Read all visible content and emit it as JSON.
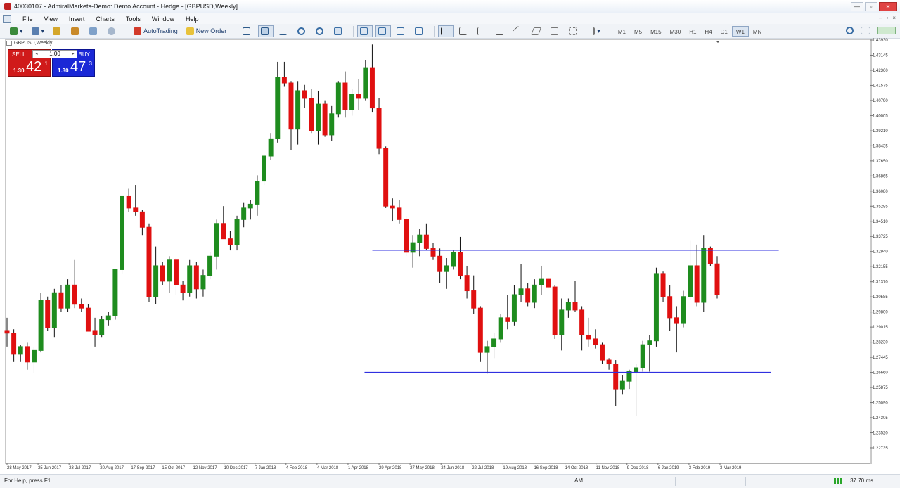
{
  "window": {
    "title": "40030107 - AdmiralMarkets-Demo: Demo Account - Hedge - [GBPUSD,Weekly]",
    "controls": [
      "—",
      "▫",
      "✕"
    ]
  },
  "menu": {
    "items": [
      "File",
      "View",
      "Insert",
      "Charts",
      "Tools",
      "Window",
      "Help"
    ]
  },
  "toolbar": {
    "autotrading_label": "AutoTrading",
    "new_order_label": "New Order",
    "timeframes": [
      "M1",
      "M5",
      "M15",
      "M30",
      "H1",
      "H4",
      "D1",
      "W1",
      "MN"
    ],
    "active_timeframe": "W1"
  },
  "chart_tab": {
    "label": "GBPUSD,Weekly"
  },
  "one_click": {
    "sell_label": "SELL",
    "buy_label": "BUY",
    "lot": "1.00",
    "sell_price_small": "1.30",
    "sell_price_big": "42",
    "sell_price_sup": "1",
    "buy_price_small": "1.30",
    "buy_price_big": "47",
    "buy_price_sup": "3"
  },
  "chart_data": {
    "type": "candlestick",
    "symbol": "GBPUSD",
    "timeframe": "Weekly",
    "ylim": [
      1.2193,
      1.4393
    ],
    "y_ticks": [
      "1.43930",
      "1.43145",
      "1.42360",
      "1.41575",
      "1.40790",
      "1.40005",
      "1.39210",
      "1.38435",
      "1.37650",
      "1.36865",
      "1.36080",
      "1.35295",
      "1.34510",
      "1.33725",
      "1.32940",
      "1.32155",
      "1.31370",
      "1.30585",
      "1.29800",
      "1.29015",
      "1.28230",
      "1.27445",
      "1.26660",
      "1.25875",
      "1.25090",
      "1.24305",
      "1.23520",
      "1.22735"
    ],
    "x_ticks": [
      "28 May 2017",
      "25 Jun 2017",
      "23 Jul 2017",
      "20 Aug 2017",
      "17 Sep 2017",
      "15 Oct 2017",
      "12 Nov 2017",
      "10 Dec 2017",
      "7 Jan 2018",
      "4 Feb 2018",
      "4 Mar 2018",
      "1 Apr 2018",
      "29 Apr 2018",
      "27 May 2018",
      "24 Jun 2018",
      "22 Jul 2018",
      "19 Aug 2018",
      "16 Sep 2018",
      "14 Oct 2018",
      "11 Nov 2018",
      "9 Dec 2018",
      "6 Jan 2019",
      "3 Feb 2019",
      "3 Mar 2019"
    ],
    "bull_color": "#1e8c1e",
    "bear_color": "#e01010",
    "candles": [
      [
        1.288,
        1.295,
        1.28,
        1.287
      ],
      [
        1.287,
        1.289,
        1.272,
        1.276
      ],
      [
        1.276,
        1.281,
        1.272,
        1.28
      ],
      [
        1.28,
        1.282,
        1.268,
        1.272
      ],
      [
        1.272,
        1.28,
        1.266,
        1.278
      ],
      [
        1.278,
        1.308,
        1.277,
        1.304
      ],
      [
        1.304,
        1.306,
        1.288,
        1.29
      ],
      [
        1.29,
        1.31,
        1.285,
        1.308
      ],
      [
        1.308,
        1.312,
        1.298,
        1.3
      ],
      [
        1.3,
        1.315,
        1.298,
        1.312
      ],
      [
        1.312,
        1.325,
        1.3,
        1.302
      ],
      [
        1.302,
        1.305,
        1.298,
        1.3
      ],
      [
        1.3,
        1.302,
        1.288,
        1.288
      ],
      [
        1.288,
        1.295,
        1.28,
        1.286
      ],
      [
        1.286,
        1.296,
        1.285,
        1.294
      ],
      [
        1.294,
        1.298,
        1.291,
        1.296
      ],
      [
        1.296,
        1.32,
        1.294,
        1.32
      ],
      [
        1.32,
        1.358,
        1.318,
        1.358
      ],
      [
        1.358,
        1.362,
        1.35,
        1.352
      ],
      [
        1.352,
        1.364,
        1.348,
        1.35
      ],
      [
        1.35,
        1.351,
        1.338,
        1.342
      ],
      [
        1.342,
        1.344,
        1.303,
        1.306
      ],
      [
        1.306,
        1.332,
        1.302,
        1.322
      ],
      [
        1.322,
        1.324,
        1.312,
        1.314
      ],
      [
        1.314,
        1.327,
        1.308,
        1.325
      ],
      [
        1.325,
        1.326,
        1.307,
        1.312
      ],
      [
        1.312,
        1.314,
        1.304,
        1.308
      ],
      [
        1.308,
        1.325,
        1.306,
        1.322
      ],
      [
        1.322,
        1.324,
        1.305,
        1.31
      ],
      [
        1.31,
        1.32,
        1.306,
        1.317
      ],
      [
        1.317,
        1.329,
        1.315,
        1.327
      ],
      [
        1.327,
        1.346,
        1.32,
        1.344
      ],
      [
        1.344,
        1.353,
        1.336,
        1.336
      ],
      [
        1.336,
        1.34,
        1.33,
        1.333
      ],
      [
        1.333,
        1.348,
        1.33,
        1.346
      ],
      [
        1.346,
        1.355,
        1.342,
        1.352
      ],
      [
        1.352,
        1.356,
        1.346,
        1.354
      ],
      [
        1.354,
        1.369,
        1.348,
        1.366
      ],
      [
        1.366,
        1.38,
        1.364,
        1.379
      ],
      [
        1.379,
        1.391,
        1.377,
        1.388
      ],
      [
        1.388,
        1.428,
        1.386,
        1.42
      ],
      [
        1.42,
        1.428,
        1.415,
        1.417
      ],
      [
        1.417,
        1.418,
        1.382,
        1.393
      ],
      [
        1.393,
        1.418,
        1.385,
        1.413
      ],
      [
        1.413,
        1.416,
        1.404,
        1.409
      ],
      [
        1.409,
        1.414,
        1.391,
        1.392
      ],
      [
        1.392,
        1.413,
        1.385,
        1.406
      ],
      [
        1.406,
        1.408,
        1.389,
        1.39
      ],
      [
        1.39,
        1.405,
        1.387,
        1.401
      ],
      [
        1.401,
        1.418,
        1.399,
        1.417
      ],
      [
        1.417,
        1.423,
        1.399,
        1.403
      ],
      [
        1.403,
        1.414,
        1.4,
        1.411
      ],
      [
        1.411,
        1.419,
        1.403,
        1.409
      ],
      [
        1.409,
        1.429,
        1.408,
        1.425
      ],
      [
        1.425,
        1.437,
        1.402,
        1.404
      ],
      [
        1.404,
        1.409,
        1.38,
        1.383
      ],
      [
        1.383,
        1.384,
        1.352,
        1.353
      ],
      [
        1.353,
        1.357,
        1.345,
        1.352
      ],
      [
        1.352,
        1.356,
        1.344,
        1.346
      ],
      [
        1.346,
        1.348,
        1.327,
        1.329
      ],
      [
        1.329,
        1.338,
        1.321,
        1.334
      ],
      [
        1.334,
        1.341,
        1.327,
        1.338
      ],
      [
        1.338,
        1.344,
        1.33,
        1.331
      ],
      [
        1.331,
        1.334,
        1.325,
        1.327
      ],
      [
        1.327,
        1.331,
        1.313,
        1.319
      ],
      [
        1.319,
        1.326,
        1.31,
        1.322
      ],
      [
        1.322,
        1.33,
        1.32,
        1.329
      ],
      [
        1.329,
        1.337,
        1.315,
        1.317
      ],
      [
        1.317,
        1.322,
        1.305,
        1.309
      ],
      [
        1.309,
        1.317,
        1.297,
        1.3
      ],
      [
        1.3,
        1.301,
        1.272,
        1.277
      ],
      [
        1.277,
        1.283,
        1.266,
        1.28
      ],
      [
        1.28,
        1.287,
        1.274,
        1.284
      ],
      [
        1.284,
        1.297,
        1.282,
        1.295
      ],
      [
        1.295,
        1.307,
        1.289,
        1.293
      ],
      [
        1.293,
        1.312,
        1.291,
        1.307
      ],
      [
        1.307,
        1.323,
        1.303,
        1.31
      ],
      [
        1.31,
        1.313,
        1.301,
        1.303
      ],
      [
        1.303,
        1.315,
        1.3,
        1.312
      ],
      [
        1.312,
        1.322,
        1.307,
        1.315
      ],
      [
        1.315,
        1.316,
        1.31,
        1.311
      ],
      [
        1.311,
        1.312,
        1.284,
        1.286
      ],
      [
        1.286,
        1.305,
        1.278,
        1.299
      ],
      [
        1.299,
        1.305,
        1.295,
        1.303
      ],
      [
        1.303,
        1.314,
        1.298,
        1.299
      ],
      [
        1.299,
        1.301,
        1.278,
        1.286
      ],
      [
        1.286,
        1.295,
        1.28,
        1.284
      ],
      [
        1.284,
        1.289,
        1.279,
        1.281
      ],
      [
        1.281,
        1.282,
        1.271,
        1.273
      ],
      [
        1.273,
        1.274,
        1.268,
        1.271
      ],
      [
        1.271,
        1.273,
        1.249,
        1.258
      ],
      [
        1.258,
        1.265,
        1.255,
        1.262
      ],
      [
        1.262,
        1.268,
        1.258,
        1.267
      ],
      [
        1.267,
        1.271,
        1.244,
        1.269
      ],
      [
        1.269,
        1.283,
        1.267,
        1.281
      ],
      [
        1.281,
        1.286,
        1.267,
        1.283
      ],
      [
        1.283,
        1.321,
        1.28,
        1.318
      ],
      [
        1.318,
        1.319,
        1.303,
        1.306
      ],
      [
        1.306,
        1.312,
        1.288,
        1.295
      ],
      [
        1.295,
        1.301,
        1.277,
        1.292
      ],
      [
        1.292,
        1.309,
        1.29,
        1.306
      ],
      [
        1.306,
        1.335,
        1.304,
        1.322
      ],
      [
        1.322,
        1.333,
        1.301,
        1.303
      ],
      [
        1.303,
        1.338,
        1.298,
        1.331
      ],
      [
        1.331,
        1.332,
        1.322,
        1.323
      ],
      [
        1.323,
        1.327,
        1.305,
        1.307
      ]
    ],
    "hlines": [
      {
        "price": 1.3301,
        "color": "#3030e0",
        "from": 0.424,
        "to": 0.894
      },
      {
        "price": 1.2666,
        "color": "#3030e0",
        "from": 0.415,
        "to": 0.885
      }
    ]
  },
  "status": {
    "help": "For Help, press F1",
    "mode": "AM",
    "ping": "37.70 ms"
  }
}
